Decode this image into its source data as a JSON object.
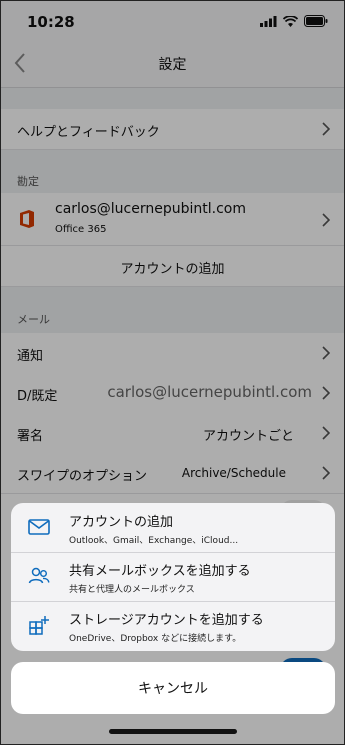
{
  "status": {
    "time": "10:28"
  },
  "nav": {
    "title": "設定"
  },
  "help_row": {
    "label": "ヘルプとフィードバック"
  },
  "accounts": {
    "heading": "勘定",
    "email": "carlos@lucernepubintl.com",
    "type": "Office 365",
    "add_label": "アカウントの追加"
  },
  "mail": {
    "heading": "メール",
    "rows": [
      {
        "label": "通知",
        "value": ""
      },
      {
        "label": "D/既定",
        "value": "carlos@lucernepubintl.com"
      },
      {
        "label": "署名",
        "value": "アカウントごと"
      },
      {
        "label": "スワイプのオプション",
        "value": "Archive/Schedule"
      }
    ]
  },
  "sheet": {
    "options": [
      {
        "title": "アカウントの追加",
        "subtitle": "Outlook、Gmail、Exchange、iCloud...",
        "icon": "mail-icon"
      },
      {
        "title": "共有メールボックスを追加する",
        "subtitle": "共有と代理人のメールボックス",
        "icon": "people-icon"
      },
      {
        "title": "ストレージアカウントを追加する",
        "subtitle": "OneDrive、Dropbox などに接続します。",
        "icon": "storage-grid-icon"
      }
    ],
    "cancel": "キャンセル"
  },
  "colors": {
    "accent": "#0f6cbd",
    "office": "#d83b01"
  }
}
